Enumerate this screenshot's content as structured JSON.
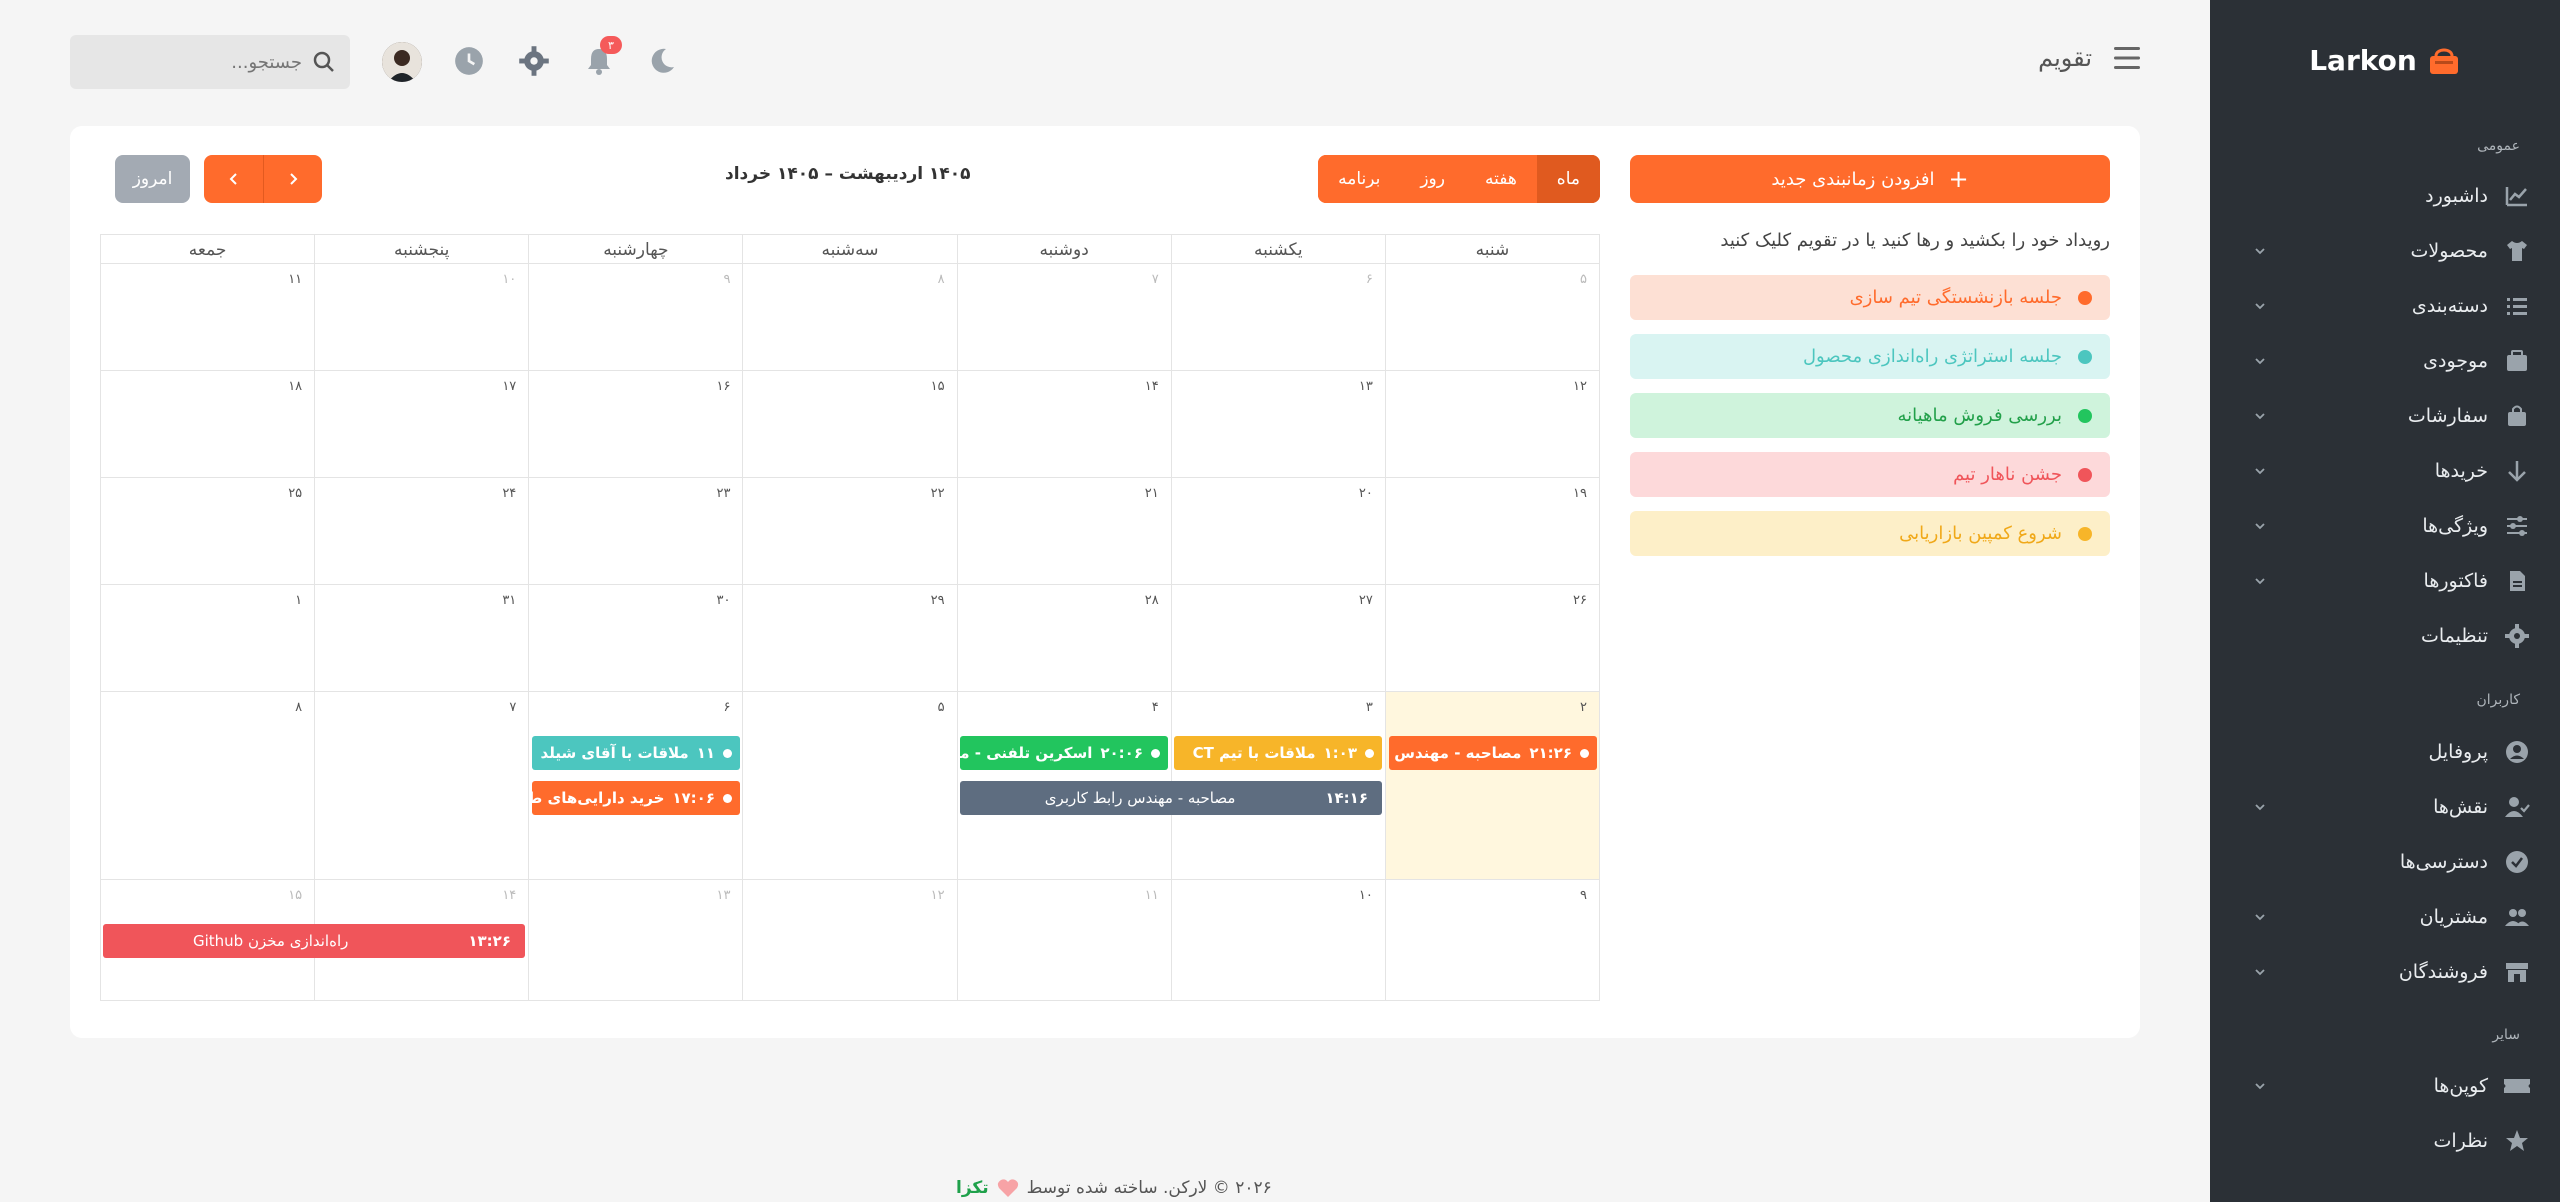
{
  "app": {
    "logo": "Larkon",
    "page_title": "تقویم"
  },
  "header": {
    "search_placeholder": "جستجو...",
    "notifications_count": "۳"
  },
  "sidebar": {
    "sections": {
      "general": "عمومی",
      "users": "کاربران",
      "other": "سایر"
    },
    "items": [
      {
        "label": "داشبورد"
      },
      {
        "label": "محصولات"
      },
      {
        "label": "دسته‌بندی"
      },
      {
        "label": "موجودی"
      },
      {
        "label": "سفارشات"
      },
      {
        "label": "خریدها"
      },
      {
        "label": "ویژگی‌ها"
      },
      {
        "label": "فاکتورها"
      },
      {
        "label": "تنظیمات"
      },
      {
        "label": "پروفایل"
      },
      {
        "label": "نقش‌ها"
      },
      {
        "label": "دسترسی‌ها"
      },
      {
        "label": "مشتریان"
      },
      {
        "label": "فروشندگان"
      },
      {
        "label": "کوپن‌ها"
      },
      {
        "label": "نظرات"
      }
    ]
  },
  "left_panel": {
    "add_button": "افزودن زمانبندی جدید",
    "drag_hint": "رویداد خود را بکشید و رها کنید یا در تقویم کلیک کنید",
    "external_events": [
      {
        "label": "جلسه بازنشستگی تیم سازی",
        "color": "#ff6b2c",
        "bg": "#fde0d4"
      },
      {
        "label": "جلسه استراتژی راه‌اندازی محصول",
        "color": "#4cc6bf",
        "bg": "#d9f4f2"
      },
      {
        "label": "بررسی فروش ماهیانه",
        "color": "#22c55e",
        "bg": "#cff3dc"
      },
      {
        "label": "جشن ناهار تیم",
        "color": "#f0555a",
        "bg": "#fdd9da"
      },
      {
        "label": "شروع کمپین بازاریابی",
        "color": "#f7b529",
        "bg": "#fdefc8"
      }
    ]
  },
  "toolbar": {
    "views": {
      "month": "ماه",
      "week": "هفته",
      "day": "روز",
      "list": "برنامه"
    },
    "range_title": "۱۴۰۵ اردیبهشت – ۱۴۰۵ خرداد",
    "today": "امروز"
  },
  "calendar": {
    "weekdays": [
      "شنبه",
      "یکشنبه",
      "دوشنبه",
      "سه‌شنبه",
      "چهارشنبه",
      "پنجشنبه",
      "جمعه"
    ],
    "weeks": [
      [
        "۵",
        "۶",
        "۷",
        "۸",
        "۹",
        "۱۰",
        "۱۱"
      ],
      [
        "۱۲",
        "۱۳",
        "۱۴",
        "۱۵",
        "۱۶",
        "۱۷",
        "۱۸"
      ],
      [
        "۱۹",
        "۲۰",
        "۲۱",
        "۲۲",
        "۲۳",
        "۲۴",
        "۲۵"
      ],
      [
        "۲۶",
        "۲۷",
        "۲۸",
        "۲۹",
        "۳۰",
        "۳۱",
        "۱"
      ],
      [
        "۲",
        "۳",
        "۴",
        "۵",
        "۶",
        "۷",
        "۸"
      ],
      [
        "۹",
        "۱۰",
        "۱۱",
        "۱۲",
        "۱۳",
        "۱۴",
        "۱۵"
      ]
    ],
    "events": [
      {
        "time": "۲۱:۲۶",
        "title": "مصاحبه - مهندس پخ",
        "color": "#ff6b2c"
      },
      {
        "time": "۱:۰۳",
        "title": "ملاقات با تیم CT",
        "color": "#f7b529"
      },
      {
        "time": "۲۰:۰۶",
        "title": "اسکرین تلفنی - مهندس",
        "color": "#22c55e"
      },
      {
        "time": "۱۱",
        "title": "ملاقات با آقای شیلد",
        "color": "#4cc6bf"
      },
      {
        "time": "۱۷:۰۶",
        "title": "خرید دارایی‌های طراح",
        "color": "#ff6b2c"
      },
      {
        "time": "۱۴:۱۶",
        "title": "مصاحبه - مهندس رابط کاربری",
        "color": "#5e6d80"
      },
      {
        "time": "۱۳:۲۶",
        "title": "راه‌اندازی مخزن Github",
        "color": "#f0555a"
      }
    ]
  },
  "footer": {
    "text": "۲۰۲۶ © لارکن. ساخته شده توسط",
    "brand": "تکزا"
  }
}
